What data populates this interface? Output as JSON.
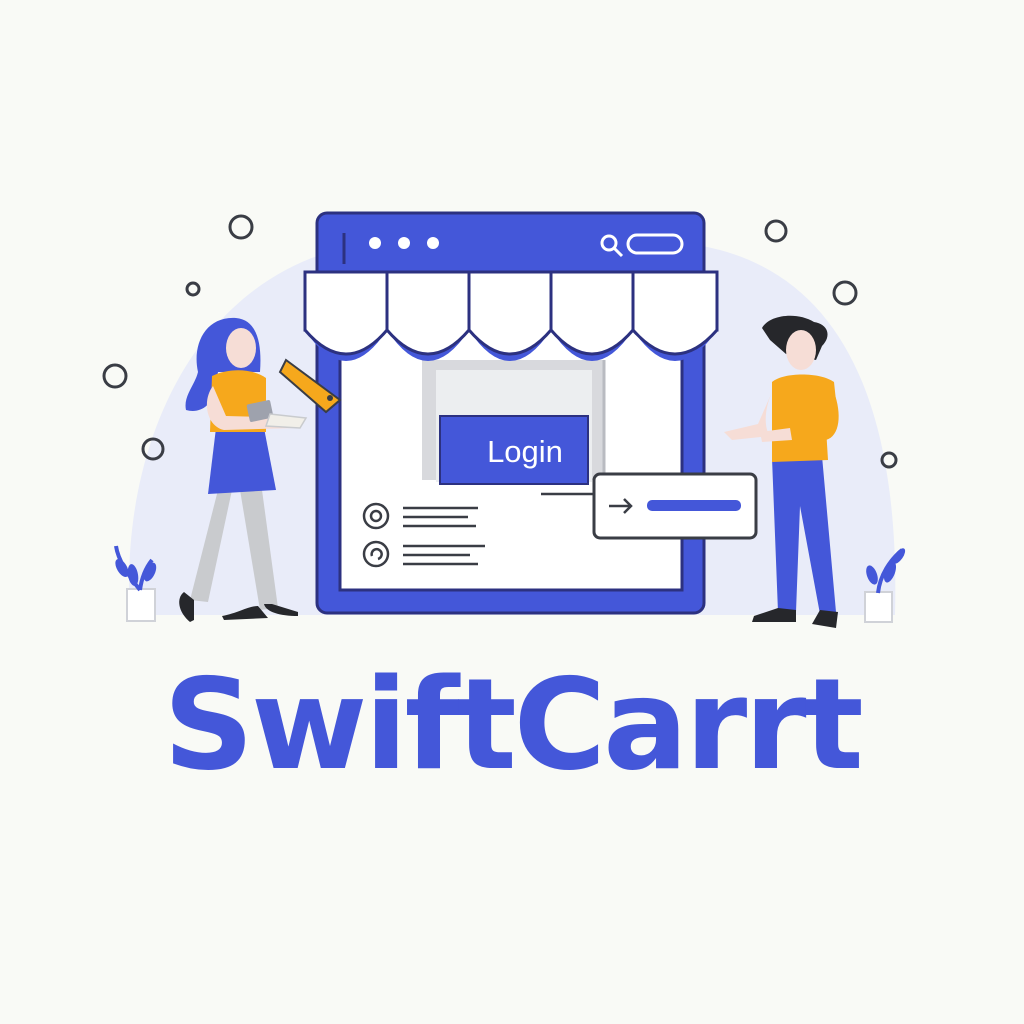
{
  "store_window": {
    "login_button_label": "Login"
  },
  "brand": {
    "name": "SwiftCarrt"
  },
  "colors": {
    "background": "#f9faf6",
    "primary_blue": "#4457d9",
    "accent_yellow": "#f6a81c",
    "blob": "#e9ecf9",
    "pants_grey": "#c9cbce"
  }
}
